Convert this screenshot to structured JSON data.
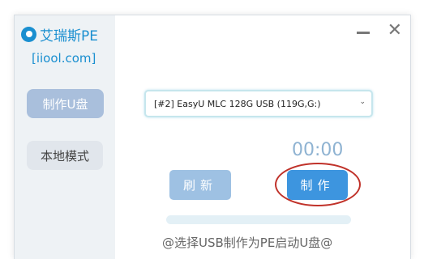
{
  "window": {
    "title": "艾瑞斯PE",
    "site": "[iiool.com]"
  },
  "sidebar": {
    "items": [
      {
        "label": "制作U盘",
        "active": true
      },
      {
        "label": "本地模式",
        "active": false
      }
    ]
  },
  "main": {
    "device_select_value": "[#2] EasyU MLC 128G USB (119G,G:)",
    "timer": "00:00",
    "refresh_label": "刷新",
    "make_label": "制作",
    "progress": 0,
    "status": "@选择USB制作为PE启动U盘@"
  },
  "icons": {
    "logo": "app-logo-icon",
    "minimize": "minimize-icon",
    "close": "close-icon",
    "dropdown": "chevron-down-icon"
  },
  "colors": {
    "accent": "#1a8fd0",
    "make_button": "#3d95df",
    "refresh_button": "#9ec1e3",
    "annotation": "#c0322a"
  }
}
